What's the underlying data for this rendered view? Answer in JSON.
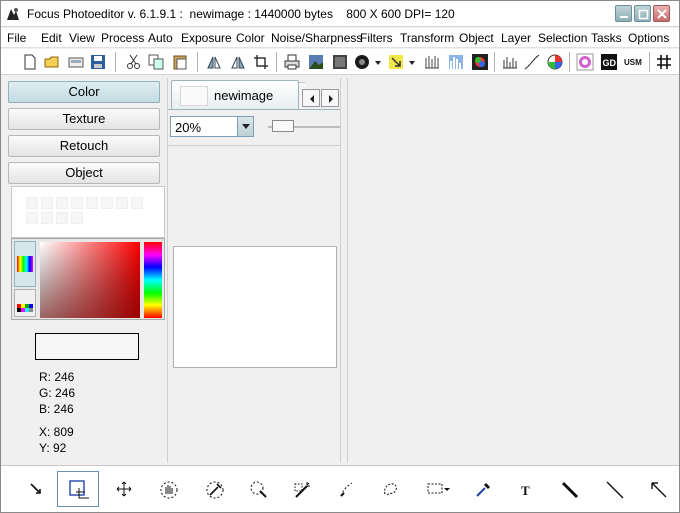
{
  "window": {
    "title": "Focus Photoeditor v. 6.1.9.1 :  newimage : 1440000 bytes    800 X 600 DPI= 120"
  },
  "menu": [
    "File",
    "Edit",
    "View",
    "Process",
    "Auto",
    "Exposure",
    "Color",
    "Noise/Sharpness",
    "Filters",
    "Transform",
    "Object",
    "Layer",
    "Selection",
    "Tasks",
    "Options"
  ],
  "side_tabs": {
    "color": "Color",
    "texture": "Texture",
    "retouch": "Retouch",
    "object": "Object"
  },
  "readout": {
    "r": "R: 246",
    "g": "G: 246",
    "b": "B: 246",
    "x": "X: 809",
    "y": "Y: 92"
  },
  "document_tab": {
    "label": "newimage"
  },
  "zoom": {
    "value": "20%"
  },
  "toolbar_icons": [
    "new-file-icon",
    "open-folder-icon",
    "scan-icon",
    "save-icon",
    "cut-icon",
    "copy-icon",
    "paste-icon",
    "flip-icon",
    "mirror-icon",
    "crop-icon",
    "print-icon",
    "landscape-icon",
    "square-icon",
    "circle-icon",
    "arrow-icon",
    "grid-icon",
    "histogram-icon",
    "color-wheel-icon",
    "gd-icon",
    "usm-icon",
    "hash-icon"
  ],
  "bottom_tools": [
    "pointer-tool-icon",
    "crop-tool-icon",
    "move-tool-icon",
    "hand-tool-icon",
    "eyedropper-tool-icon",
    "zoom-tool-icon",
    "magic-wand-tool-icon",
    "brush-tool-icon",
    "lasso-tool-icon",
    "rect-select-tool-icon",
    "dropper-tool-icon",
    "text-tool-icon",
    "line-tool-icon",
    "straight-line-tool-icon",
    "arrow-line-tool-icon"
  ],
  "text_tool_glyph": "T",
  "colors": {
    "accent": "#c2dbe1",
    "preview_color": "#f6f6f6"
  }
}
